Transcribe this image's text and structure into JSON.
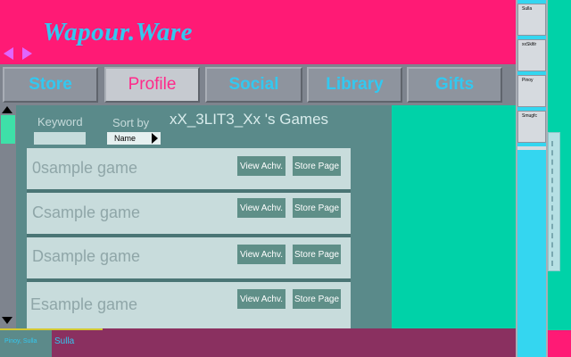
{
  "app": {
    "title": "Wapour.Ware"
  },
  "nav": {
    "back_icon": "left-arrow-icon",
    "forward_icon": "right-arrow-icon"
  },
  "tabs": [
    {
      "label": "Store",
      "active": false
    },
    {
      "label": "Profile",
      "active": true
    },
    {
      "label": "Social",
      "active": false
    },
    {
      "label": "Library",
      "active": false
    },
    {
      "label": "Gifts",
      "active": false
    }
  ],
  "filters": {
    "keyword_label": "Keyword",
    "keyword_value": "",
    "sort_label": "Sort by",
    "sort_value": "Name"
  },
  "games": {
    "heading": "xX_3LIT3_Xx 's Games",
    "items": [
      {
        "name": "0sample game",
        "achv_label": "View Achv.",
        "store_label": "Store Page"
      },
      {
        "name": "Csample game",
        "achv_label": "View Achv.",
        "store_label": "Store Page"
      },
      {
        "name": "Dsample game",
        "achv_label": "View Achv.",
        "store_label": "Store Page"
      },
      {
        "name": "Esample game",
        "achv_label": "View Achv.",
        "store_label": "Store Page"
      }
    ]
  },
  "friends": [
    {
      "name": "Sulla"
    },
    {
      "name": "xxSkltlr"
    },
    {
      "name": "Pinoy"
    },
    {
      "name": "Smugfc"
    }
  ],
  "chat_tabs": [
    {
      "label": "Pinoy, Sulla"
    },
    {
      "label": "Sulla"
    }
  ],
  "colors": {
    "background": "#ff1a75",
    "accent_title": "#33c8f0",
    "active_tab_text": "#ff2a8a",
    "panel": "#5a8a8a",
    "right_pane": "#00d2a8",
    "friends_column": "#34d6f0"
  }
}
